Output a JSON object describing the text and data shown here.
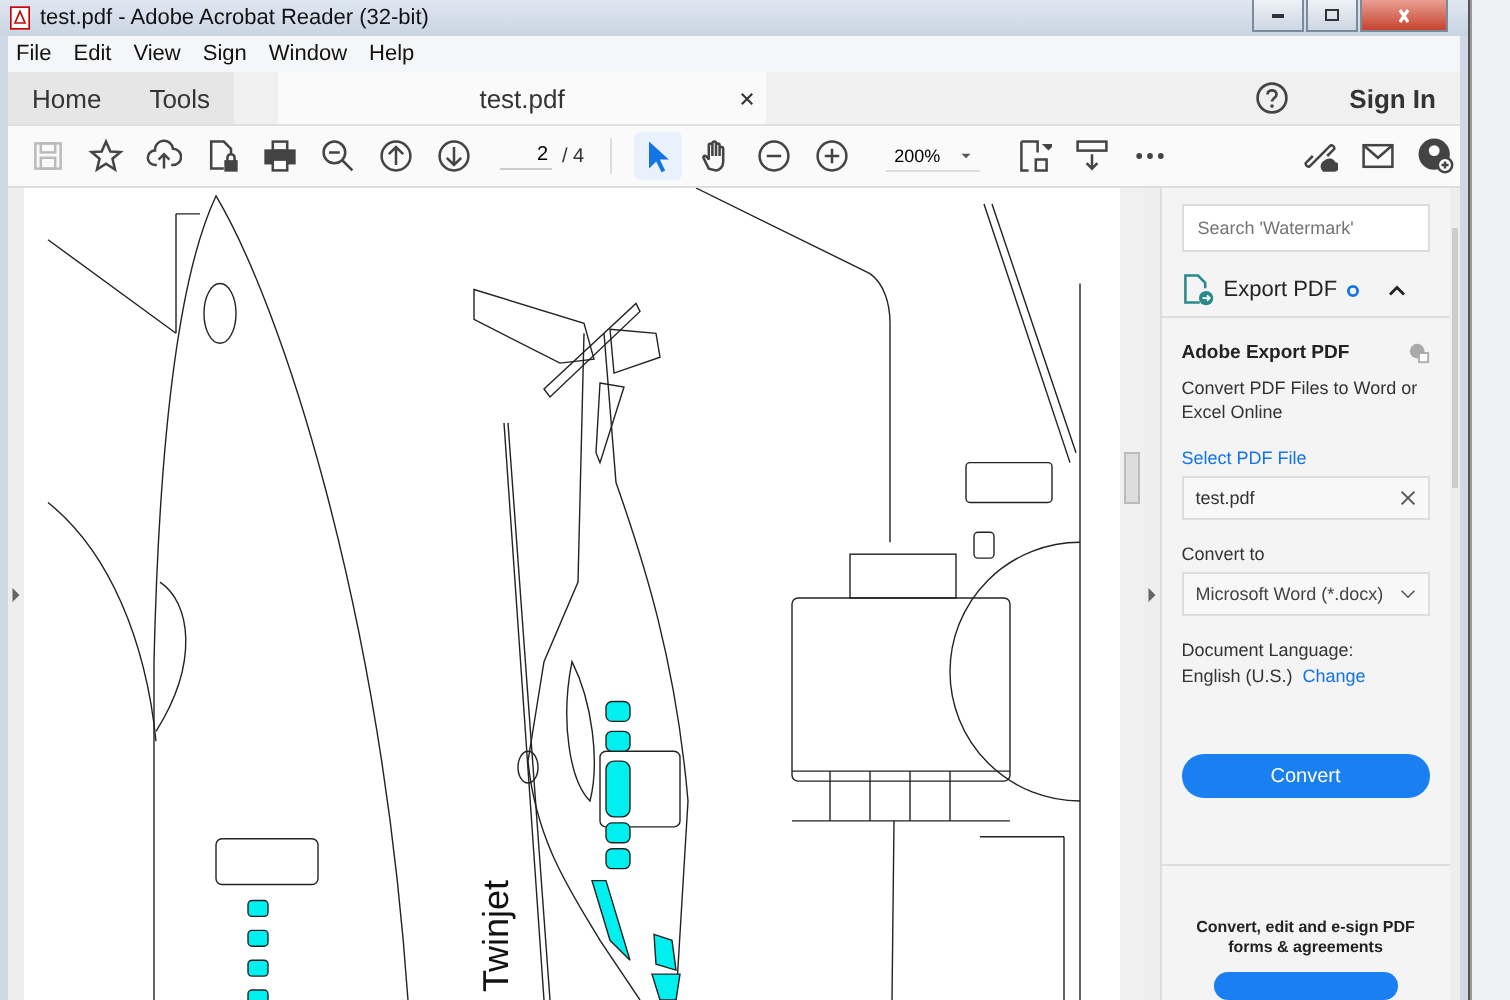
{
  "window": {
    "title": "test.pdf - Adobe Acrobat Reader (32-bit)"
  },
  "menu": [
    "File",
    "Edit",
    "View",
    "Sign",
    "Window",
    "Help"
  ],
  "tabs": [
    {
      "label": "Home",
      "selected": false
    },
    {
      "label": "Tools",
      "selected": false
    },
    {
      "label": "test.pdf",
      "selected": true
    }
  ],
  "sign_in": "Sign In",
  "toolbar": {
    "save": {
      "disabled": true
    },
    "tools": [
      {
        "kind": "star"
      },
      {
        "kind": "upload"
      },
      {
        "kind": "lockfile"
      },
      {
        "kind": "print"
      },
      {
        "kind": "zoomsearch"
      },
      {
        "kind": "up"
      },
      {
        "kind": "down"
      }
    ],
    "page_current": "2",
    "page_total": "/ 4",
    "modes": [
      {
        "kind": "pointer",
        "selected": true
      },
      {
        "kind": "hand",
        "selected": false
      }
    ],
    "zoom_tools": [
      {
        "kind": "minus"
      },
      {
        "kind": "plus"
      }
    ],
    "zoom": "200%",
    "view_tools": [
      {
        "kind": "fit"
      },
      {
        "kind": "scroll"
      },
      {
        "kind": "more"
      }
    ]
  },
  "document": {
    "label": "Twinjet"
  },
  "panel": {
    "search_placeholder": "Search 'Watermark'",
    "export_title": "Export PDF",
    "expanded": true,
    "heading": "Adobe Export PDF",
    "description": "Convert PDF Files to Word or Excel Online",
    "select_label": "Select PDF File",
    "file": "test.pdf",
    "convert_label": "Convert to",
    "format": "Microsoft Word (*.docx)",
    "language_label": "Document Language:",
    "language": "English (U.S.)",
    "change_link": "Change",
    "convert_button": "Convert",
    "promo": "Convert, edit and e-sign PDF forms & agreements"
  }
}
